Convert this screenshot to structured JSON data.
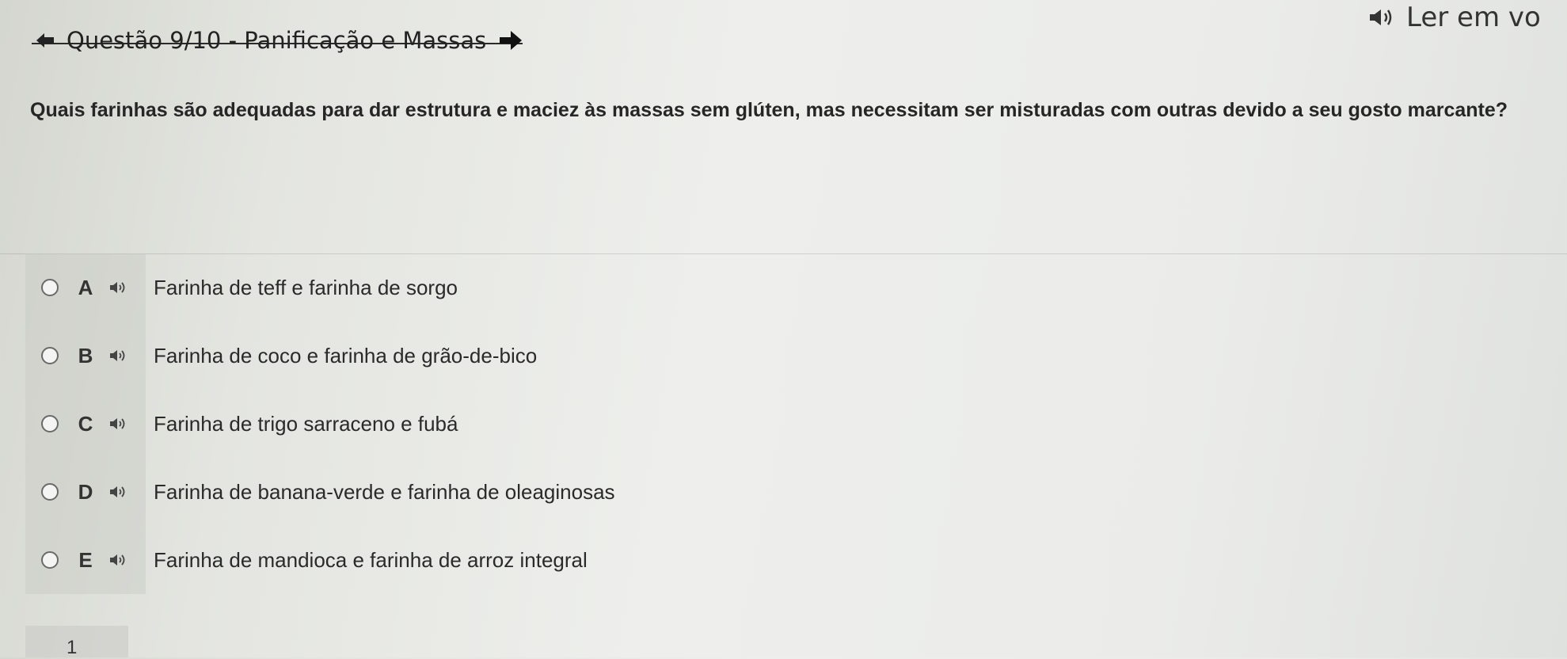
{
  "read_aloud": {
    "label": "Ler em vo",
    "icon": "speaker-icon"
  },
  "header": {
    "title": "Questão 9/10 - Panificação e Massas",
    "prev_icon": "arrow-left-icon",
    "next_icon": "arrow-right-icon"
  },
  "question": {
    "text": "Quais farinhas são adequadas para dar estrutura e maciez às massas sem glúten, mas necessitam ser misturadas com outras devido a seu gosto marcante?"
  },
  "options": [
    {
      "letter": "A",
      "text": "Farinha de teff e farinha de sorgo"
    },
    {
      "letter": "B",
      "text": "Farinha de coco e farinha de grão-de-bico"
    },
    {
      "letter": "C",
      "text": "Farinha de trigo sarraceno e fubá"
    },
    {
      "letter": "D",
      "text": "Farinha de banana-verde e farinha de oleaginosas"
    },
    {
      "letter": "E",
      "text": "Farinha de mandioca e farinha de arroz integral"
    }
  ],
  "pagination": {
    "current": "1"
  }
}
